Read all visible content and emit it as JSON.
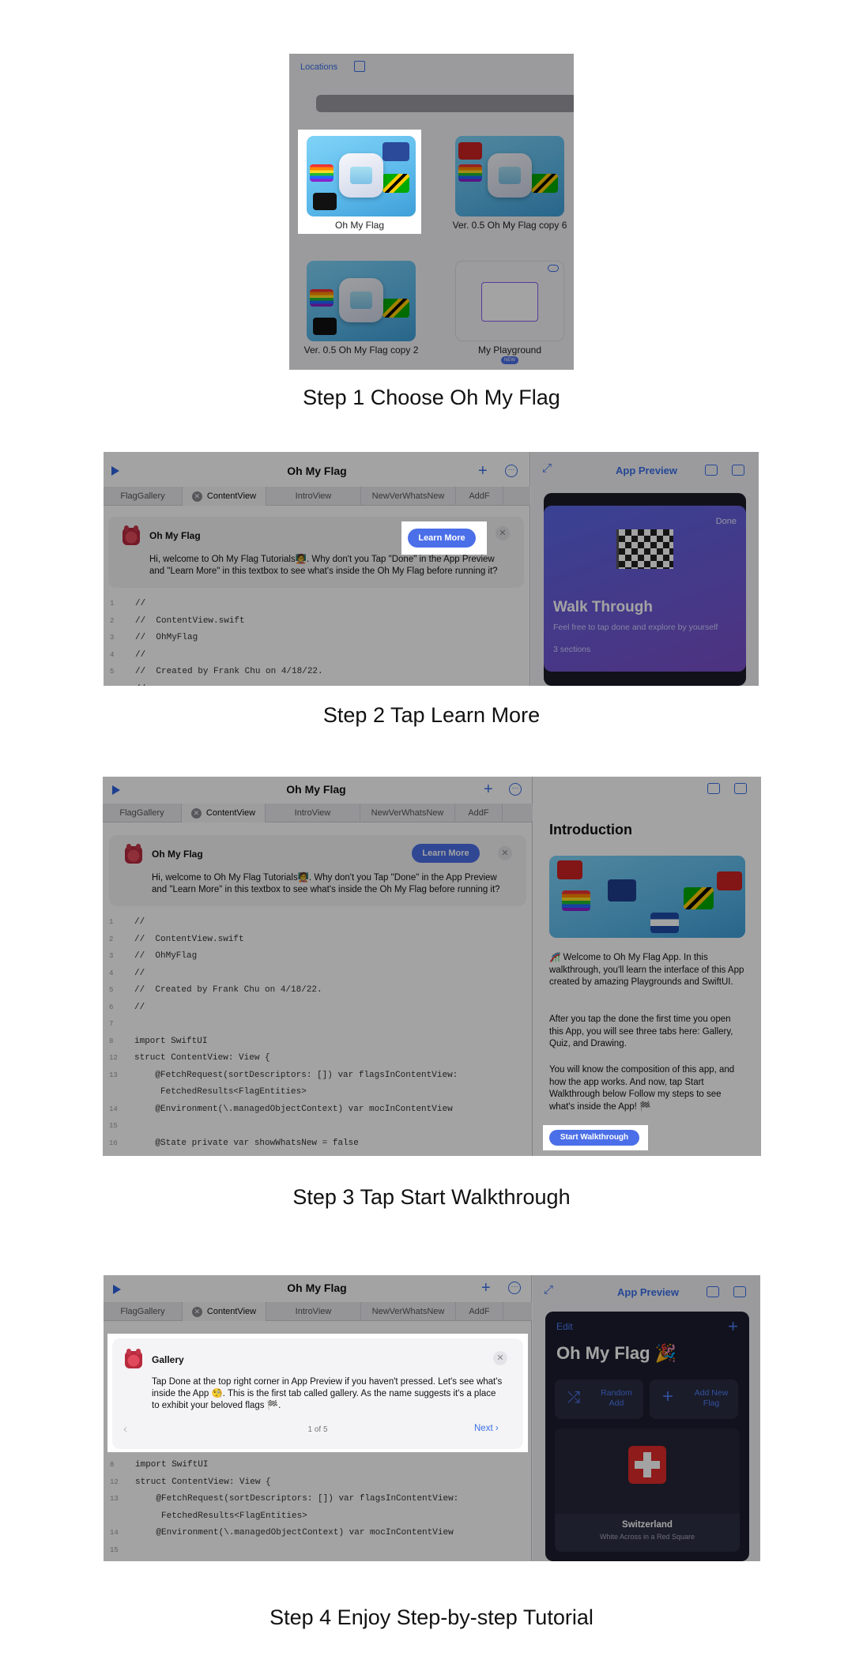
{
  "step1": {
    "caption": "Step 1 Choose Oh My Flag",
    "nav_title": "Locations",
    "tiles": [
      {
        "label": "Oh My Flag"
      },
      {
        "label": "Ver. 0.5 Oh My Flag copy 6"
      },
      {
        "label": "Ver. 0.5 Oh My Flag copy 2"
      },
      {
        "label": "My Playground",
        "badge": "NEW"
      }
    ]
  },
  "step2": {
    "caption": "Step 2 Tap Learn More",
    "editor_title": "Oh My Flag",
    "tabs": [
      "FlagGallery",
      "ContentView",
      "IntroView",
      "NewVerWhatsNew",
      "AddF"
    ],
    "card_title": "Oh My Flag",
    "card_body_1": "Hi, welcome to Oh My Flag Tutorials🧑‍🏫. Why don't you Tap \"Done\" in the App Preview",
    "card_body_2": "and \"Learn More\" in this textbox to see what's inside the Oh My Flag before running it?",
    "learn_more": "Learn More",
    "preview_title": "App Preview",
    "done": "Done",
    "walk_title": "Walk Through",
    "walk_sub": "Feel free to tap done and explore by yourself",
    "walk_sections": "3 sections",
    "code": [
      {
        "n": "1",
        "t": "//"
      },
      {
        "n": "2",
        "t": "//  ContentView.swift"
      },
      {
        "n": "3",
        "t": "//  OhMyFlag"
      },
      {
        "n": "4",
        "t": "//"
      },
      {
        "n": "5",
        "t": "//  Created by Frank Chu on 4/18/22."
      },
      {
        "n": "6",
        "t": "//"
      }
    ]
  },
  "step3": {
    "caption": "Step 3 Tap Start Walkthrough",
    "editor_title": "Oh My Flag",
    "card_title": "Oh My Flag",
    "learn_more": "Learn More",
    "intro_title": "Introduction",
    "para1": "🎢 Welcome to Oh My Flag App. In this walkthrough, you'll learn the interface of this App created by amazing Playgrounds and SwiftUI.",
    "para2": "After you tap the done the first time you open this App, you will see three tabs here: Gallery, Quiz, and Drawing.",
    "para3": "You will know the composition of this app, and how the app works. And now, tap Start Walkthrough below Follow my steps to see what's inside the App! 🏁",
    "start_btn": "Start Walkthrough",
    "code": [
      {
        "n": "1",
        "t": "//"
      },
      {
        "n": "2",
        "t": "//  ContentView.swift"
      },
      {
        "n": "3",
        "t": "//  OhMyFlag"
      },
      {
        "n": "4",
        "t": "//"
      },
      {
        "n": "5",
        "t": "//  Created by Frank Chu on 4/18/22."
      },
      {
        "n": "6",
        "t": "//"
      },
      {
        "n": "7",
        "t": ""
      },
      {
        "n": "8",
        "t": "import SwiftUI"
      },
      {
        "n": "12",
        "t": "struct ContentView: View {"
      },
      {
        "n": "13",
        "t": "    @FetchRequest(sortDescriptors: []) var flagsInContentView:"
      },
      {
        "n": "",
        "t": "     FetchedResults<FlagEntities>"
      },
      {
        "n": "14",
        "t": "    @Environment(\\.managedObjectContext) var mocInContentView"
      },
      {
        "n": "15",
        "t": ""
      },
      {
        "n": "16",
        "t": "    @State private var showWhatsNew = false"
      }
    ]
  },
  "step4": {
    "caption": "Step 4 Enjoy Step-by-step Tutorial",
    "editor_title": "Oh My Flag",
    "card_title": "Gallery",
    "card_body_1": "Tap Done at the top right corner in App Preview if you haven't pressed. Let's see what's",
    "card_body_2": "inside the App 🧐. This is the first tab called gallery. As the name suggests it's a place",
    "card_body_3": "to exhibit your beloved flags 🏁.",
    "pager": "1 of 5",
    "next": "Next",
    "preview_title": "App Preview",
    "edit": "Edit",
    "app_title": "Oh My Flag 🎉",
    "random_add": "Random Add",
    "add_new_flag": "Add New Flag",
    "flag_emoji": "🇨🇭",
    "country": "Switzerland",
    "country_desc": "White Across in a Red Square",
    "code": [
      {
        "n": "8",
        "t": "import SwiftUI"
      },
      {
        "n": "12",
        "t": "struct ContentView: View {"
      },
      {
        "n": "13",
        "t": "    @FetchRequest(sortDescriptors: []) var flagsInContentView:"
      },
      {
        "n": "",
        "t": "     FetchedResults<FlagEntities>"
      },
      {
        "n": "14",
        "t": "    @Environment(\\.managedObjectContext) var mocInContentView"
      },
      {
        "n": "15",
        "t": ""
      }
    ]
  }
}
